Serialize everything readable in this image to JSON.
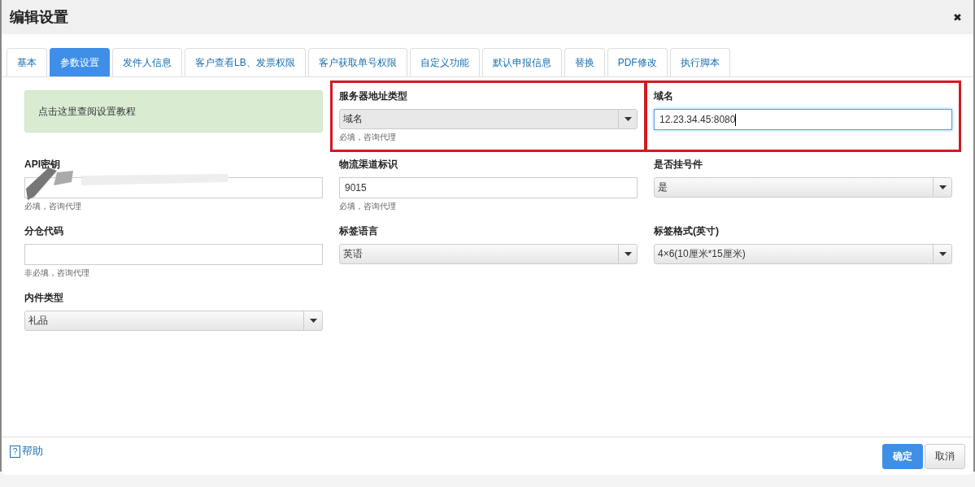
{
  "dialog": {
    "title": "编辑设置",
    "close": "✖"
  },
  "tabs": [
    {
      "label": "基本",
      "selected": false
    },
    {
      "label": "参数设置",
      "selected": true
    },
    {
      "label": "发件人信息",
      "selected": false
    },
    {
      "label": "客户查看LB、发票权限",
      "selected": false
    },
    {
      "label": "客户获取单号权限",
      "selected": false
    },
    {
      "label": "自定义功能",
      "selected": false
    },
    {
      "label": "默认申报信息",
      "selected": false
    },
    {
      "label": "替换",
      "selected": false
    },
    {
      "label": "PDF修改",
      "selected": false
    },
    {
      "label": "执行脚本",
      "selected": false
    }
  ],
  "tutorial_link": "点击这里查阅设置教程",
  "fields": [
    {
      "kind": "select",
      "label": "服务器地址类型",
      "value": "域名",
      "hint": "必填，咨询代理",
      "highlighted": true,
      "disabled": true
    },
    {
      "kind": "input",
      "label": "域名",
      "value": "12.23.34.45:8080",
      "highlighted": true,
      "focused": true
    },
    {
      "kind": "input",
      "label": "API密钥",
      "hint": "必填，咨询代理",
      "redacted": true
    },
    {
      "kind": "input",
      "label": "物流渠道标识",
      "value": "9015",
      "hint": "必填，咨询代理"
    },
    {
      "kind": "select",
      "label": "是否挂号件",
      "value": "是"
    },
    {
      "kind": "input",
      "label": "分仓代码",
      "hint": "非必填，咨询代理"
    },
    {
      "kind": "select",
      "label": "标签语言",
      "value": "英语"
    },
    {
      "kind": "select",
      "label": "标签格式(英寸)",
      "value": "4×6(10厘米*15厘米)"
    },
    {
      "kind": "select",
      "label": "内件类型",
      "value": "礼品"
    }
  ],
  "footer": {
    "help": "帮助",
    "help_icon": "?",
    "buttons": [
      {
        "label": "确定",
        "kind": "primary"
      },
      {
        "label": "取消",
        "kind": "default"
      }
    ]
  }
}
